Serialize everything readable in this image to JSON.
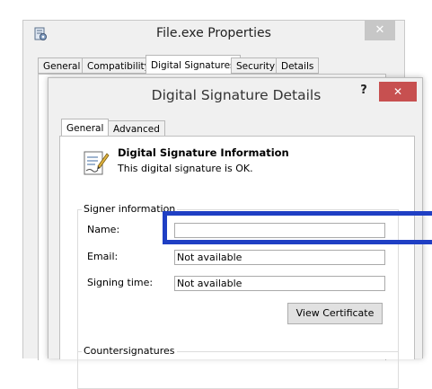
{
  "outer_window": {
    "title": "File.exe Properties",
    "close_glyph": "✕",
    "tabs": [
      {
        "label": "General",
        "selected": false
      },
      {
        "label": "Compatibility",
        "selected": false
      },
      {
        "label": "Digital Signatures",
        "selected": true
      },
      {
        "label": "Security",
        "selected": false
      },
      {
        "label": "Details",
        "selected": false
      }
    ]
  },
  "dialog": {
    "title": "Digital Signature Details",
    "help_glyph": "?",
    "close_glyph": "✕",
    "tabs": [
      {
        "label": "General",
        "selected": true
      },
      {
        "label": "Advanced",
        "selected": false
      }
    ],
    "info": {
      "heading": "Digital Signature Information",
      "text": "This digital signature is OK."
    },
    "signer_group": {
      "label": "Signer information",
      "fields": [
        {
          "label": "Name:",
          "value": ""
        },
        {
          "label": "Email:",
          "value": "Not available"
        },
        {
          "label": "Signing time:",
          "value": "Not available"
        }
      ],
      "view_certificate_label": "View Certificate"
    },
    "countersignatures_label": "Countersignatures"
  },
  "colors": {
    "highlight": "#1f3fc4",
    "dialog_close": "#c75050",
    "outer_close": "#c7c7c7"
  }
}
